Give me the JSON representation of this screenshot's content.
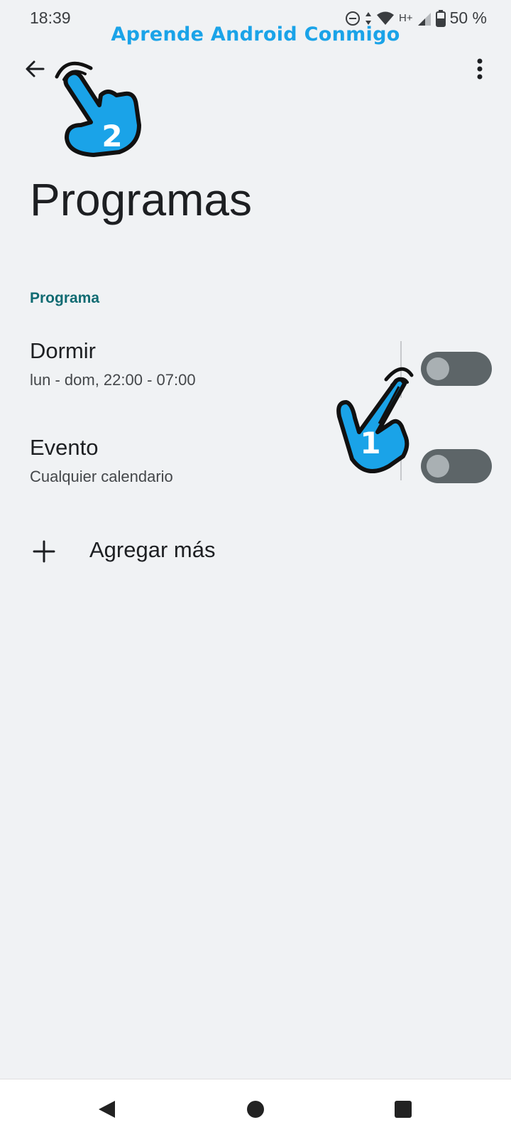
{
  "status": {
    "time": "18:39",
    "network": "H+",
    "battery": "50 %"
  },
  "watermark": "Aprende Android Conmigo",
  "app_bar": {
    "back_icon": "arrow-back-icon",
    "more_icon": "more-vert-icon"
  },
  "page": {
    "title": "Programas",
    "section_header": "Programa",
    "items": [
      {
        "title": "Dormir",
        "subtitle": "lun - dom, 22:00 - 07:00",
        "enabled": false
      },
      {
        "title": "Evento",
        "subtitle": "Cualquier calendario",
        "enabled": false
      }
    ],
    "add_label": "Agregar más"
  },
  "annotations": {
    "hand_1_number": "1",
    "hand_2_number": "2",
    "hand_color": "#1aa3e8"
  },
  "colors": {
    "background": "#f0f2f4",
    "accent": "#106b72",
    "switch_track": "#5d6568"
  }
}
